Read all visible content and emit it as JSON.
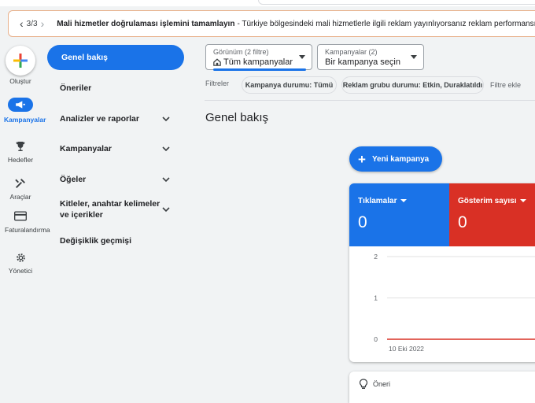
{
  "colors": {
    "accent": "#1a73e8",
    "clicks": "#1a73e8",
    "impressions": "#d93025",
    "warning": "#e37400"
  },
  "alert": {
    "pager": "3/3",
    "title": "Mali hizmetler doğrulaması işlemini tamamlayın",
    "body": "- Türkiye bölgesindeki mali hizmetlerle ilgili reklam yayınlıyorsanız reklam performansınız Mali hizmetl",
    "icon": "warning-icon"
  },
  "rail": {
    "create": "Oluştur",
    "campaigns": "Kampanyalar",
    "goals": "Hedefler",
    "tools": "Araçlar",
    "billing": "Faturalandırma",
    "admin": "Yönetici"
  },
  "nav": {
    "items": [
      {
        "label": "Genel bakış",
        "active": true,
        "expandable": false
      },
      {
        "label": "Öneriler",
        "active": false,
        "expandable": false
      },
      {
        "label": "Analizler ve raporlar",
        "active": false,
        "expandable": true
      },
      {
        "label": "Kampanyalar",
        "active": false,
        "expandable": true
      },
      {
        "label": "Öğeler",
        "active": false,
        "expandable": true
      },
      {
        "label": "Kitleler, anahtar kelimeler ve içerikler",
        "active": false,
        "expandable": true
      },
      {
        "label": "Değişiklik geçmişi",
        "active": false,
        "expandable": false
      }
    ]
  },
  "pickers": {
    "view": {
      "small": "Görünüm (2 filtre)",
      "main": "Tüm kampanyalar"
    },
    "campaign": {
      "small": "Kampanyalar (2)",
      "main": "Bir kampanya seçin"
    }
  },
  "filters": {
    "label": "Filtreler",
    "chips": [
      "Kampanya durumu: Tümü",
      "Reklam grubu durumu: Etkin, Duraklatıldı"
    ],
    "add": "Filtre ekle"
  },
  "page_title": "Genel bakış",
  "new_campaign": "Yeni kampanya",
  "metrics": [
    {
      "name": "Tıklamalar",
      "value": "0",
      "color": "#1a73e8"
    },
    {
      "name": "Gösterim sayısı",
      "value": "0",
      "color": "#d93025"
    }
  ],
  "chart_data": {
    "type": "line",
    "x": [
      "10 Eki 2022"
    ],
    "xlabel": "",
    "ylabel": "",
    "ylim": [
      0,
      2
    ],
    "yticks": [
      "2",
      "1",
      "0"
    ],
    "series": [
      {
        "values": [
          0
        ],
        "color": "#d93025"
      }
    ]
  },
  "recommendations": {
    "label": "Öneri"
  }
}
